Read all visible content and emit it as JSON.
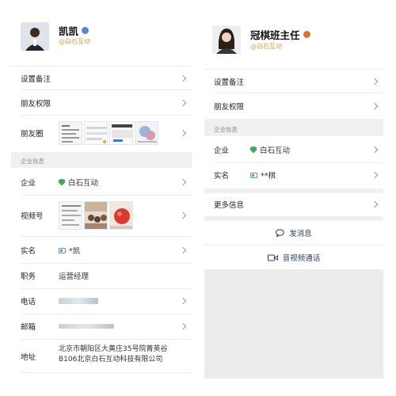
{
  "left": {
    "profile": {
      "name": "凯凯",
      "company": "@白石互动",
      "badge_color": "#5b86c8"
    },
    "rows": {
      "remark": "设置备注",
      "permission": "朋友权限",
      "moments": "朋友圈"
    },
    "enterprise_section": "企业信息",
    "enterprise": {
      "company_label": "企业",
      "company_value": "白石互动",
      "video_label": "视频号",
      "realname_label": "实名",
      "realname_value": "*凯",
      "position_label": "职务",
      "position_value": "运营经理",
      "phone_label": "电话",
      "email_label": "邮箱",
      "address_label": "地址",
      "address_line1": "北京市朝阳区大黄庄35号院菁英谷",
      "address_line2": "B106北京白石互动科技有限公司"
    }
  },
  "right": {
    "profile": {
      "name": "冠棋班主任",
      "company": "@白石互动",
      "badge_color": "#e0703b"
    },
    "rows": {
      "remark": "设置备注",
      "permission": "朋友权限"
    },
    "enterprise_section": "企业信息",
    "enterprise": {
      "company_label": "企业",
      "company_value": "白石互动",
      "realname_label": "实名",
      "realname_value": "**棋"
    },
    "more_info": "更多信息",
    "send_message": "发消息",
    "video_call": "音视频通话"
  },
  "colors": {
    "accent_gold": "#d2a24c",
    "shield_green": "#3aa95b",
    "link_navy": "#2d3e5e",
    "section_bg": "#f0f0f0"
  }
}
